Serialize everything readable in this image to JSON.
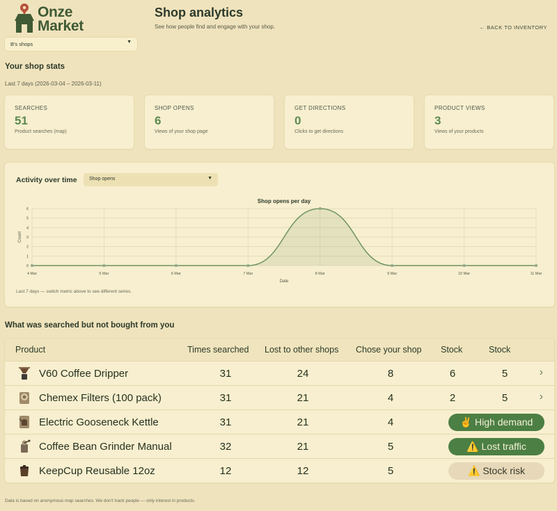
{
  "brand": {
    "name_line1": "Onze",
    "name_line2": "Market"
  },
  "header": {
    "title": "Shop analytics",
    "subtitle": "See how people find and engage with your shop.",
    "back_link": "← BACK TO INVENTORY"
  },
  "shop_select": {
    "value": "B's shops"
  },
  "stats": {
    "title": "Your shop stats",
    "range": "Last 7 days (2026-03-04 – 2026-03-11)",
    "cards": [
      {
        "label": "SEARCHES",
        "value": "51",
        "desc": "Product searches (map)"
      },
      {
        "label": "SHOP OPENS",
        "value": "6",
        "desc": "Views of your shop page"
      },
      {
        "label": "GET DIRECTIONS",
        "value": "0",
        "desc": "Clicks to get directions"
      },
      {
        "label": "PRODUCT VIEWS",
        "value": "3",
        "desc": "Views of your products"
      }
    ]
  },
  "activity": {
    "title": "Activity over time",
    "metric": "Shop opens",
    "footnote": "Last 7 days — switch metric above to see different series."
  },
  "chart_data": {
    "type": "area",
    "title": "Shop opens per day",
    "xlabel": "Date",
    "ylabel": "Count",
    "categories": [
      "4 Mar",
      "5 Mar",
      "6 Mar",
      "7 Mar",
      "8 Mar",
      "9 Mar",
      "10 Mar",
      "11 Mar"
    ],
    "values": [
      0,
      0,
      0,
      0,
      6,
      0,
      0,
      0
    ],
    "ylim": [
      0,
      6
    ],
    "yticks": [
      "0",
      "1",
      "2",
      "3",
      "4",
      "5",
      "6"
    ],
    "grid": true,
    "color": "#6f9460"
  },
  "lost": {
    "title": "What was searched but not bought from you",
    "columns": [
      "Product",
      "Times searched",
      "Lost to other shops",
      "Chose your shop",
      "Stock",
      "Stock"
    ],
    "rows": [
      {
        "product": "V60 Coffee Dripper",
        "searched": "31",
        "lost": "24",
        "chose": "8",
        "stock1": "6",
        "stock2": "5",
        "icon": "dripper-icon"
      },
      {
        "product": "Chemex Filters (100 pack)",
        "searched": "31",
        "lost": "21",
        "chose": "4",
        "stock1": "2",
        "stock2": "5",
        "icon": "filter-icon"
      },
      {
        "product": "Electric Gooseneck Kettle",
        "searched": "31",
        "lost": "21",
        "chose": "4",
        "badge": "✌️ High demand",
        "icon": "kettle-icon"
      },
      {
        "product": "Coffee Bean Grinder Manual",
        "searched": "32",
        "lost": "21",
        "chose": "5",
        "badge": "⚠️ Lost traffic",
        "icon": "grinder-icon"
      },
      {
        "product": "KeepCup Reusable 12oz",
        "searched": "12",
        "lost": "12",
        "chose": "5",
        "badge": "⚠️ Stock risk",
        "icon": "cup-icon"
      }
    ]
  },
  "footer": "Data is based on anonymous map searches. We don't track people — only interest in products."
}
